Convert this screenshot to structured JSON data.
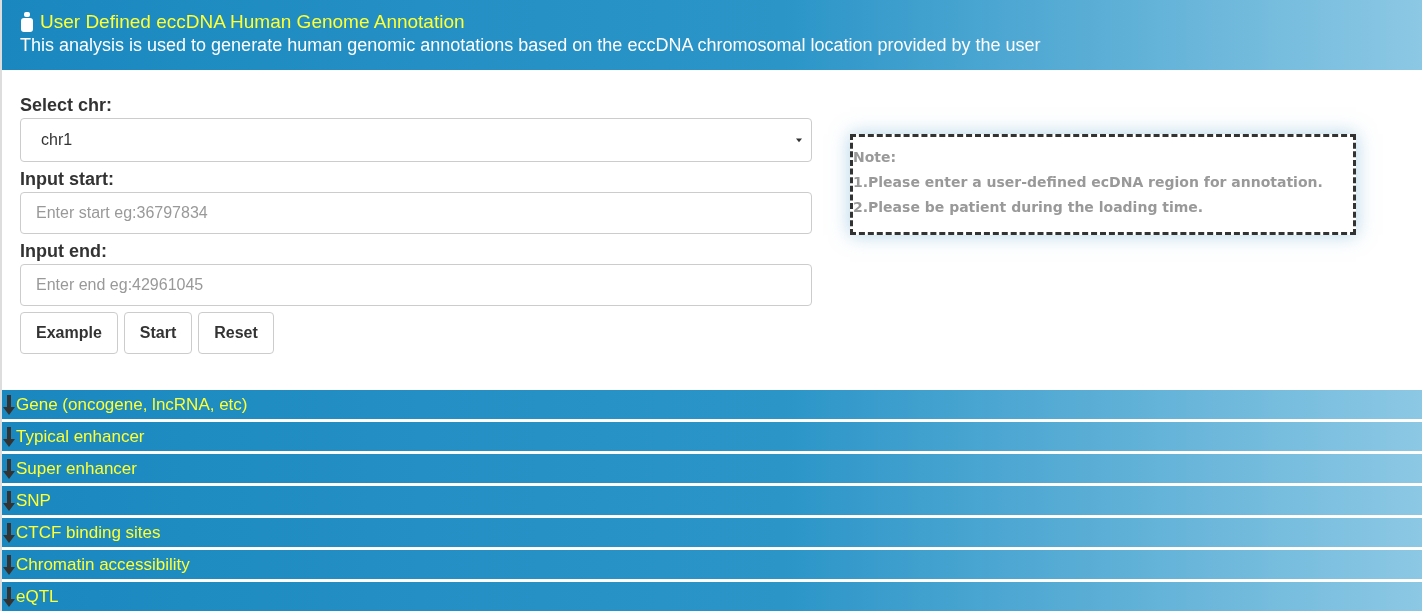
{
  "header": {
    "title": "User Defined eccDNA Human Genome Annotation",
    "subtitle": "This analysis is used to generate human genomic annotations based on the eccDNA chromosomal location provided by the user"
  },
  "form": {
    "fields": [
      {
        "kind": "select",
        "label": "Select chr:",
        "value": "chr1"
      },
      {
        "kind": "input",
        "label": "Input start:",
        "placeholder": "Enter start eg:36797834"
      },
      {
        "kind": "input",
        "label": "Input end:",
        "placeholder": "Enter end eg:42961045"
      }
    ],
    "buttons": [
      "Example",
      "Start",
      "Reset"
    ]
  },
  "note": {
    "title": "Note:",
    "items": [
      "1.Please enter a user-defined ecDNA region for annotation.",
      "2.Please be patient during the loading time."
    ]
  },
  "sections": [
    {
      "label": "Gene (oncogene, lncRNA, etc)"
    },
    {
      "label": "Typical enhancer"
    },
    {
      "label": "Super enhancer"
    },
    {
      "label": "SNP"
    },
    {
      "label": "CTCF binding sites"
    },
    {
      "label": "Chromatin accessibility"
    },
    {
      "label": "eQTL"
    }
  ]
}
